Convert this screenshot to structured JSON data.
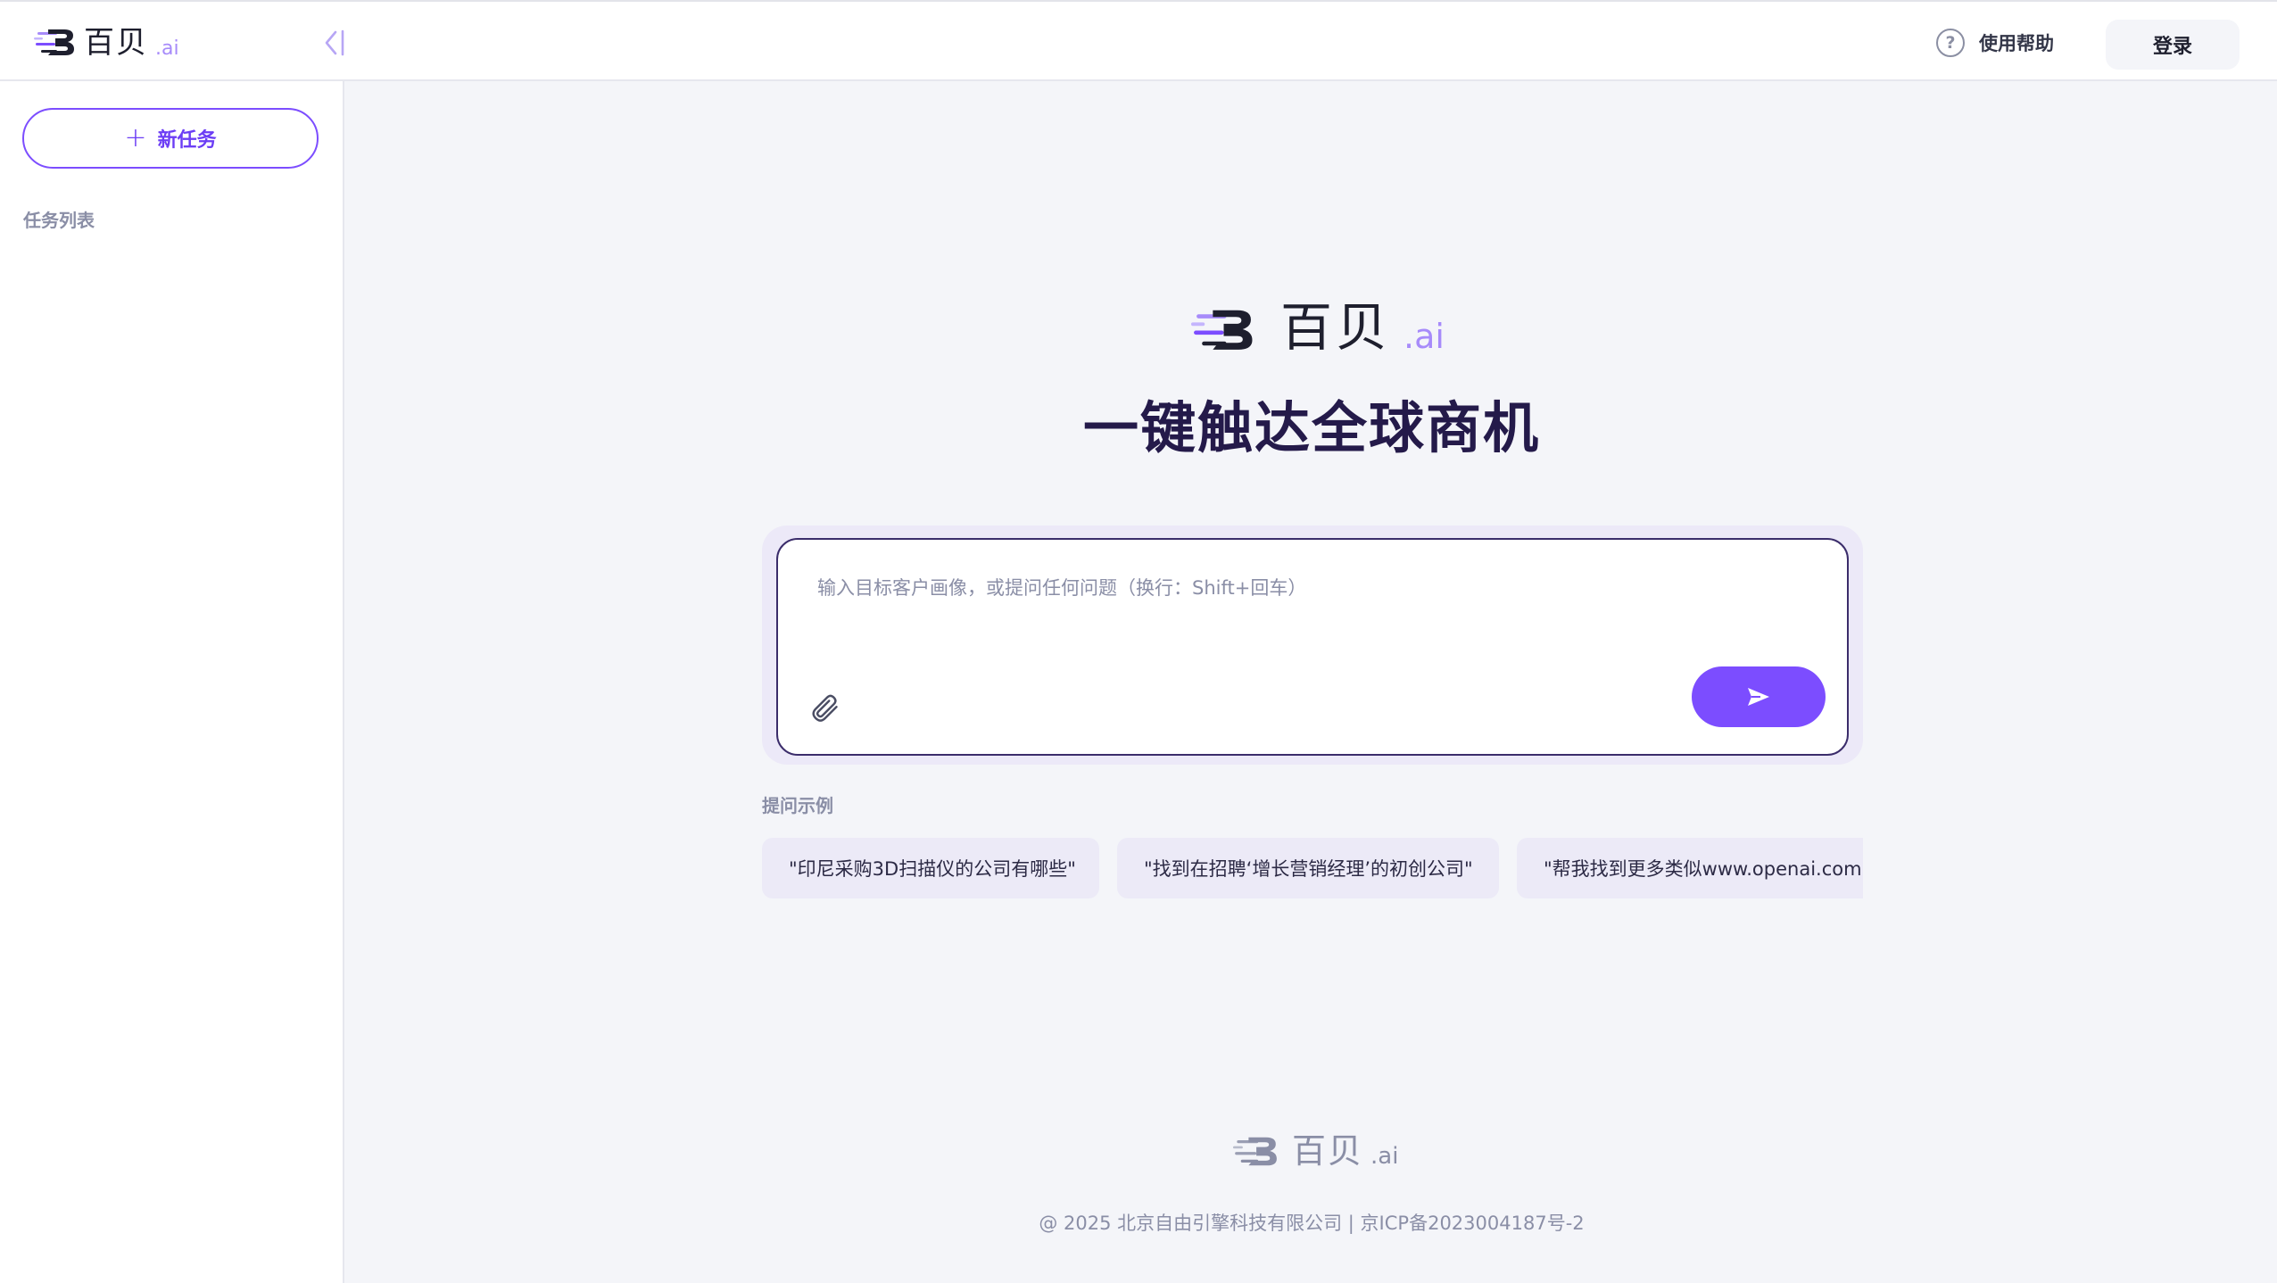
{
  "brand": {
    "name": "百贝",
    "suffix": ".ai",
    "accent_color": "#7c4dff",
    "icon": "baibei-logo-icon"
  },
  "header": {
    "help_icon": "question-circle-icon",
    "help_label": "使用帮助",
    "login_label": "登录",
    "collapse_icon": "collapse-left-icon"
  },
  "sidebar": {
    "new_task_label": "新任务",
    "new_task_icon": "plus-icon",
    "task_list_title": "任务列表"
  },
  "main": {
    "slogan": "一键触达全球商机",
    "input_placeholder": "输入目标客户画像，或提问任何问题（换行：Shift+回车）",
    "attach_icon": "paperclip-icon",
    "send_icon": "send-arrow-icon",
    "examples_title": "提问示例",
    "examples": [
      "\"印尼采购3D扫描仪的公司有哪些\"",
      "\"找到在招聘‘增长营销经理’的初创公司\"",
      "\"帮我找到更多类似www.openai.com的公司\""
    ]
  },
  "footer": {
    "copyright": "@ 2025 北京自由引擎科技有限公司 | 京ICP备2023004187号-2"
  }
}
